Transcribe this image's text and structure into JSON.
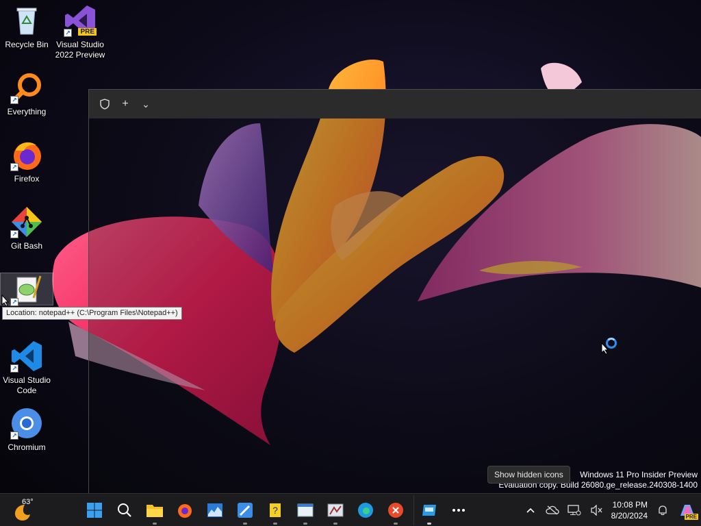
{
  "desktop": {
    "icons": [
      {
        "label": "Recycle Bin"
      },
      {
        "label": "Visual Studio 2022 Preview",
        "badge": "PRE"
      },
      {
        "label": "Everything"
      },
      {
        "label": "Firefox"
      },
      {
        "label": "Git Bash"
      },
      {
        "label": "Notepad++"
      },
      {
        "label": "Visual Studio Code"
      },
      {
        "label": "Chromium"
      }
    ],
    "tooltip": "Location: notepad++ (C:\\Program Files\\Notepad++)"
  },
  "terminal": {
    "tab_add": "+",
    "tab_dropdown": "⌄"
  },
  "watermark": {
    "line1": "Windows 11 Pro Insider Preview",
    "line2": "Evaluation copy. Build 26080.ge_release.240308-1400"
  },
  "taskbar": {
    "weather_temp": "63°",
    "apps": [
      "start",
      "search",
      "file-explorer",
      "firefox",
      "task-manager",
      "paint",
      "help",
      "notepad",
      "snipping-tool",
      "edge",
      "xmind",
      "app-window",
      "more"
    ],
    "hidden_icons_tooltip": "Show hidden icons",
    "clock_time": "10:08 PM",
    "clock_date": "8/20/2024",
    "copilot_badge": "PRE"
  },
  "colors": {
    "taskbar_bg": "#1c1c1f",
    "accent": "#2f8fe8"
  }
}
